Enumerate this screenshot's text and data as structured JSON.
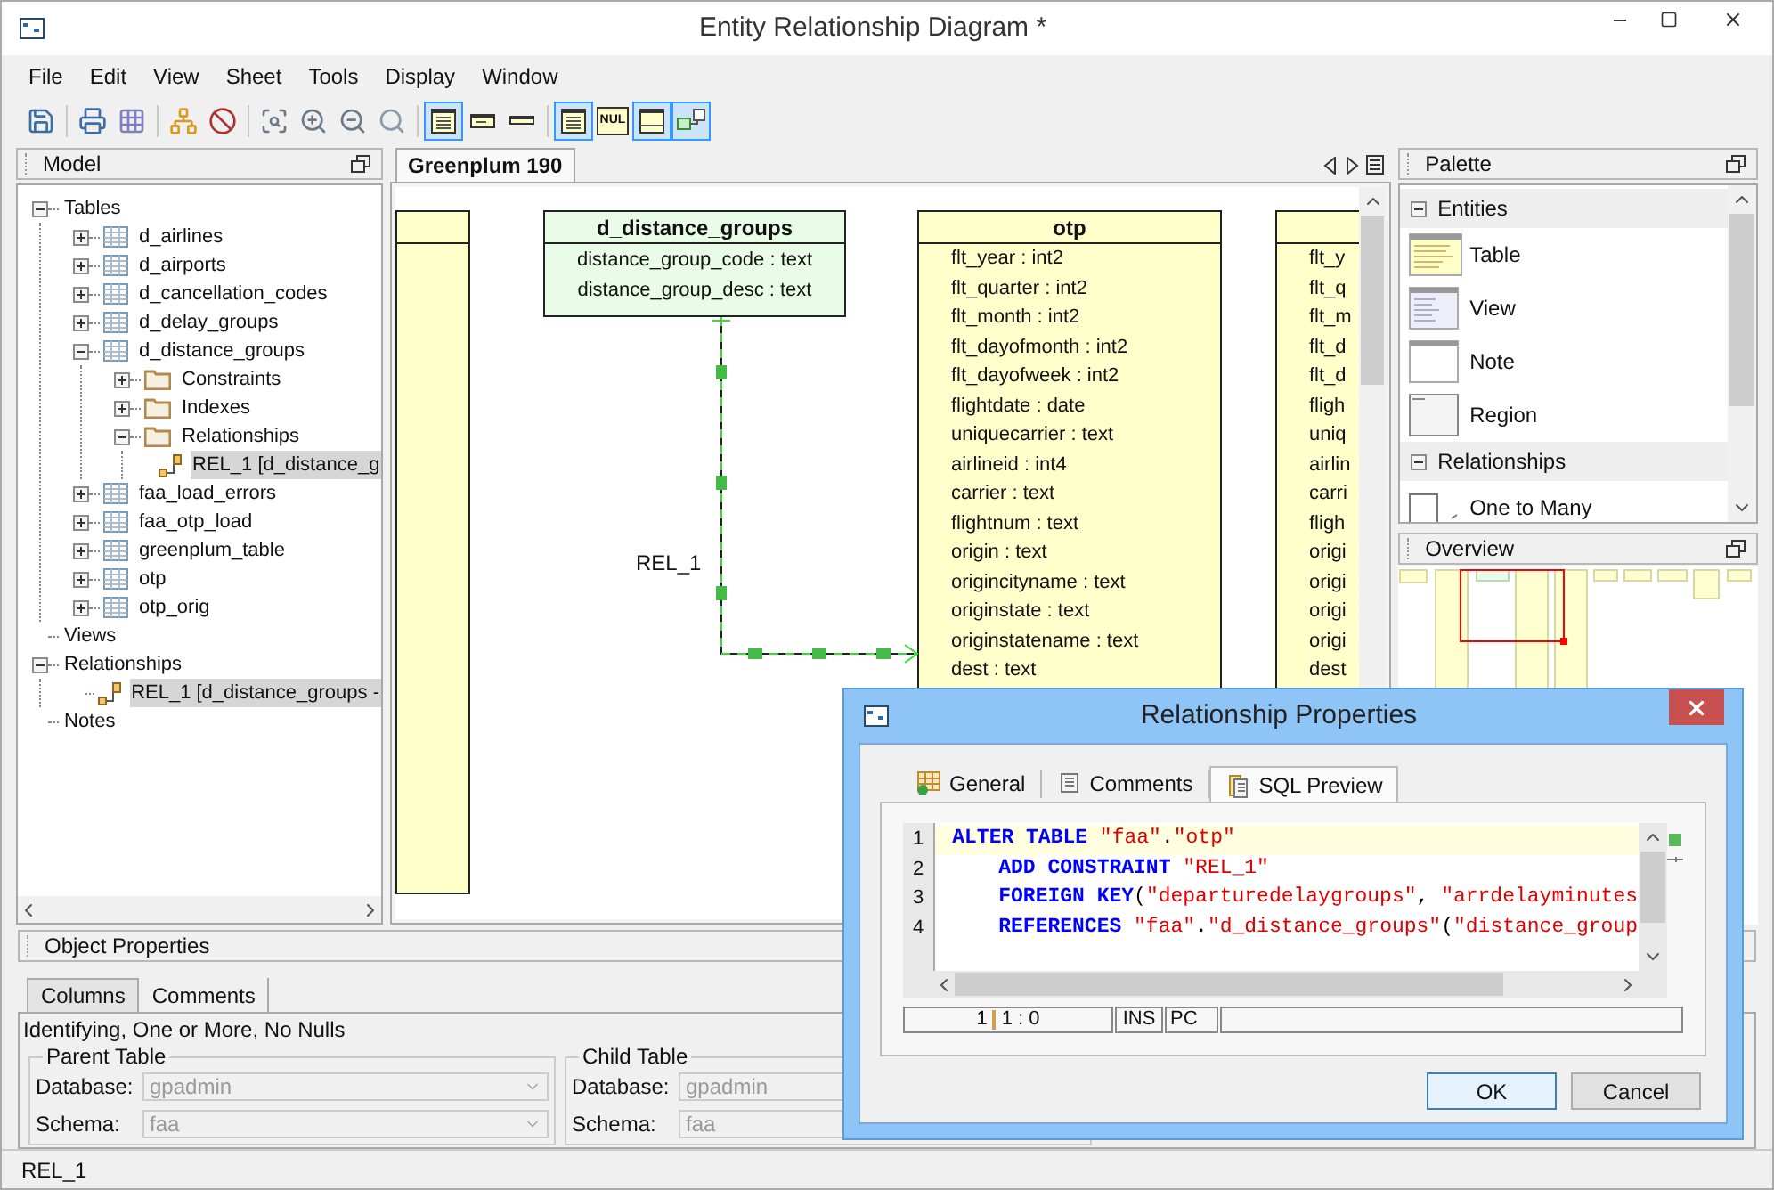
{
  "window": {
    "title": "Entity Relationship Diagram *"
  },
  "menu": [
    "File",
    "Edit",
    "View",
    "Sheet",
    "Tools",
    "Display",
    "Window"
  ],
  "toolbar": [
    {
      "kind": "save",
      "pressed": false
    },
    {
      "kind": "separator"
    },
    {
      "kind": "print",
      "pressed": false
    },
    {
      "kind": "grid",
      "pressed": false
    },
    {
      "kind": "separator"
    },
    {
      "kind": "layout",
      "pressed": false
    },
    {
      "kind": "forbidden",
      "pressed": false
    },
    {
      "kind": "separator"
    },
    {
      "kind": "zoom-fit",
      "pressed": false
    },
    {
      "kind": "zoom-in",
      "pressed": false
    },
    {
      "kind": "zoom-out",
      "pressed": false
    },
    {
      "kind": "zoom",
      "pressed": false
    },
    {
      "kind": "separator"
    },
    {
      "kind": "table-full",
      "pressed": true
    },
    {
      "kind": "table-name",
      "pressed": false
    },
    {
      "kind": "table-title",
      "pressed": false
    },
    {
      "kind": "separator"
    },
    {
      "kind": "table-full",
      "pressed": true
    },
    {
      "kind": "null",
      "pressed": false,
      "label": "NUL"
    },
    {
      "kind": "table-header",
      "pressed": true
    },
    {
      "kind": "key-link",
      "pressed": true
    }
  ],
  "model": {
    "title": "Model",
    "tree": [
      {
        "label": "Tables",
        "kind": "group",
        "expanded": true,
        "selected": false,
        "children": [
          {
            "label": "d_airlines",
            "kind": "table",
            "expanded": false,
            "selected": false
          },
          {
            "label": "d_airports",
            "kind": "table",
            "expanded": false,
            "selected": false
          },
          {
            "label": "d_cancellation_codes",
            "kind": "table",
            "expanded": false,
            "selected": false
          },
          {
            "label": "d_delay_groups",
            "kind": "table",
            "expanded": false,
            "selected": false
          },
          {
            "label": "d_distance_groups",
            "kind": "table",
            "expanded": true,
            "selected": false,
            "children": [
              {
                "label": "Constraints",
                "kind": "folder",
                "expanded": false,
                "selected": false
              },
              {
                "label": "Indexes",
                "kind": "folder",
                "expanded": false,
                "selected": false
              },
              {
                "label": "Relationships",
                "kind": "folder",
                "expanded": true,
                "selected": false,
                "children": [
                  {
                    "label": "REL_1 [d_distance_g",
                    "kind": "relationship",
                    "selected": true
                  }
                ]
              }
            ]
          },
          {
            "label": "faa_load_errors",
            "kind": "table",
            "expanded": false,
            "selected": false
          },
          {
            "label": "faa_otp_load",
            "kind": "table",
            "expanded": false,
            "selected": false
          },
          {
            "label": "greenplum_table",
            "kind": "table",
            "expanded": false,
            "selected": false
          },
          {
            "label": "otp",
            "kind": "table",
            "expanded": false,
            "selected": false
          },
          {
            "label": "otp_orig",
            "kind": "table",
            "expanded": false,
            "selected": false
          }
        ]
      },
      {
        "label": "Views",
        "kind": "category",
        "selected": false
      },
      {
        "label": "Relationships",
        "kind": "group",
        "expanded": true,
        "selected": false,
        "children": [
          {
            "label": "REL_1 [d_distance_groups -",
            "kind": "relationship",
            "selected": true
          }
        ]
      },
      {
        "label": "Notes",
        "kind": "category",
        "selected": false
      }
    ]
  },
  "editor": {
    "tabs": [
      {
        "label": "Greenplum 190",
        "selected": true
      }
    ],
    "tables": [
      {
        "color": "#ffffcc"
      },
      {
        "name": "d_distance_groups",
        "color": "#e8fce8",
        "columns": [
          "distance_group_code : text",
          "distance_group_desc : text"
        ]
      },
      {
        "name": "otp",
        "color": "#ffffcc",
        "columns": [
          "flt_year : int2",
          "flt_quarter : int2",
          "flt_month : int2",
          "flt_dayofmonth : int2",
          "flt_dayofweek : int2",
          "flightdate : date",
          "uniquecarrier : text",
          "airlineid : int4",
          "carrier : text",
          "flightnum : text",
          "origin : text",
          "origincityname : text",
          "originstate : text",
          "originstatename : text",
          "dest : text"
        ]
      },
      {
        "color": "#ffffcc",
        "columns": [
          "flt_y",
          "flt_q",
          "flt_m",
          "flt_d",
          "flt_d",
          "fligh",
          "uniq",
          "airlin",
          "carri",
          "fligh",
          "origi",
          "origi",
          "origi",
          "origi",
          "dest"
        ]
      }
    ],
    "relationship": {
      "label": "REL_1"
    }
  },
  "palette": {
    "title": "Palette",
    "sections": [
      {
        "title": "Entities",
        "expanded": true,
        "items": [
          {
            "label": "Table",
            "kind": "table"
          },
          {
            "label": "View",
            "kind": "view"
          },
          {
            "label": "Note",
            "kind": "note"
          },
          {
            "label": "Region",
            "kind": "region"
          }
        ]
      },
      {
        "title": "Relationships",
        "expanded": true,
        "items": [
          {
            "label": "One to Many",
            "kind": "one-to-many"
          }
        ]
      }
    ]
  },
  "overview": {
    "title": "Overview"
  },
  "object_properties": {
    "title": "Object Properties",
    "tabs": [
      {
        "label": "Columns",
        "selected": true
      },
      {
        "label": "Comments",
        "selected": false
      }
    ],
    "summary": "Identifying, One or More, No Nulls",
    "groups": [
      {
        "title": "Parent Table",
        "fields": [
          {
            "label": "Database:",
            "value": "gpadmin",
            "disabled": true
          },
          {
            "label": "Schema:",
            "value": "faa",
            "disabled": true
          }
        ]
      },
      {
        "title": "Child Table",
        "fields": [
          {
            "label": "Database:",
            "value": "gpadmin",
            "disabled": true
          },
          {
            "label": "Schema:",
            "value": "faa",
            "disabled": true
          }
        ]
      }
    ]
  },
  "status_bar": "REL_1",
  "dialog": {
    "title": "Relationship Properties",
    "tabs": [
      {
        "label": "General",
        "kind": "general",
        "selected": false
      },
      {
        "label": "Comments",
        "kind": "comments",
        "selected": false
      },
      {
        "label": "SQL Preview",
        "kind": "sql",
        "selected": true
      }
    ],
    "code": [
      {
        "number": "1",
        "current": true,
        "indented": false,
        "tokens": [
          {
            "kind": "keyword",
            "text": "ALTER TABLE"
          },
          {
            "kind": "string",
            "text": " \"faa\""
          },
          {
            "kind": "plain",
            "text": "."
          },
          {
            "kind": "string",
            "text": "\"otp\""
          }
        ]
      },
      {
        "number": "2",
        "current": false,
        "indented": true,
        "tokens": [
          {
            "kind": "keyword",
            "text": "ADD CONSTRAINT"
          },
          {
            "kind": "string",
            "text": " \"REL_1\""
          }
        ]
      },
      {
        "number": "3",
        "current": false,
        "indented": true,
        "tokens": [
          {
            "kind": "keyword",
            "text": "FOREIGN KEY"
          },
          {
            "kind": "plain",
            "text": "("
          },
          {
            "kind": "string",
            "text": "\"departuredelaygroups\""
          },
          {
            "kind": "plain",
            "text": ", "
          },
          {
            "kind": "string",
            "text": "\"arrdelayminutes"
          }
        ]
      },
      {
        "number": "4",
        "current": false,
        "indented": true,
        "tokens": [
          {
            "kind": "keyword",
            "text": "REFERENCES"
          },
          {
            "kind": "string",
            "text": " \"faa\""
          },
          {
            "kind": "plain",
            "text": "."
          },
          {
            "kind": "string",
            "text": "\"d_distance_groups\""
          },
          {
            "kind": "plain",
            "text": "("
          },
          {
            "kind": "string",
            "text": "\"distance_group"
          }
        ]
      }
    ],
    "status": {
      "line": "1",
      "position": "1 : 0",
      "mode": "INS",
      "line_ending": "PC"
    },
    "buttons": [
      {
        "label": "OK",
        "default": true
      },
      {
        "label": "Cancel",
        "default": false
      }
    ]
  }
}
